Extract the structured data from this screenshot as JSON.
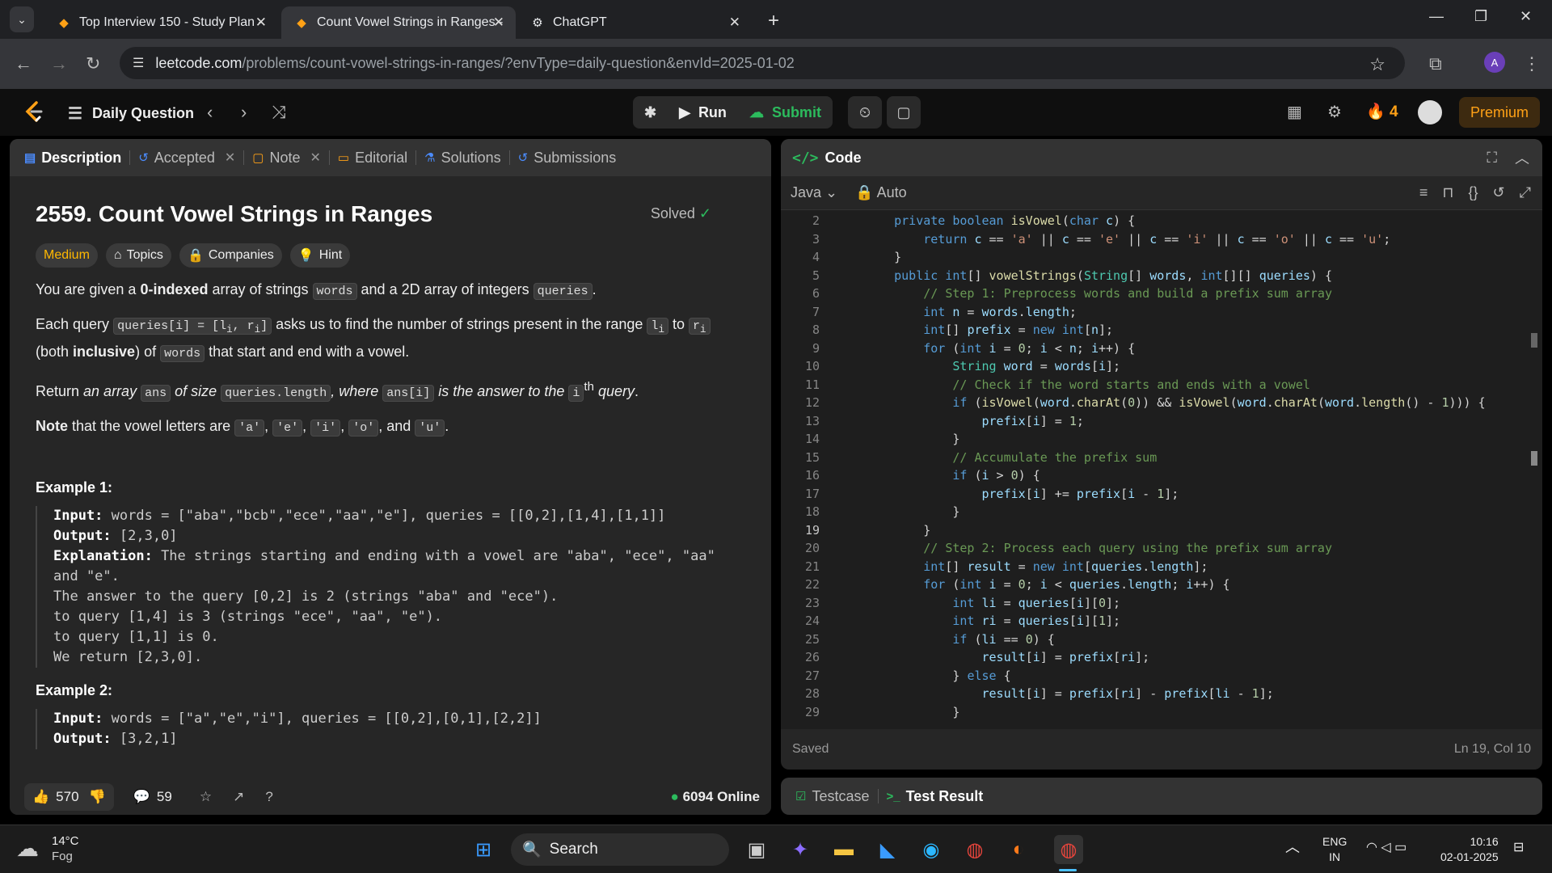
{
  "browser": {
    "tabs": [
      {
        "title": "Top Interview 150 - Study Plan -"
      },
      {
        "title": "Count Vowel Strings in Ranges -"
      },
      {
        "title": "ChatGPT"
      }
    ],
    "url_domain": "leetcode.com",
    "url_path": "/problems/count-vowel-strings-in-ranges/?envType=daily-question&envId=2025-01-02",
    "profile_initial": "A"
  },
  "header": {
    "daily_question": "Daily Question",
    "run": "Run",
    "submit": "Submit",
    "streak": "4",
    "premium": "Premium"
  },
  "left_tabs": {
    "description": "Description",
    "accepted": "Accepted",
    "note": "Note",
    "editorial": "Editorial",
    "solutions": "Solutions",
    "submissions": "Submissions"
  },
  "problem": {
    "title": "2559. Count Vowel Strings in Ranges",
    "status": "Solved",
    "difficulty": "Medium",
    "topics": "Topics",
    "companies": "Companies",
    "hint": "Hint",
    "example1_h": "Example 1:",
    "example2_h": "Example 2:"
  },
  "stats": {
    "likes": "570",
    "comments": "59",
    "online": "6094 Online"
  },
  "code": {
    "header": "Code",
    "language": "Java",
    "mode": "Auto",
    "saved": "Saved",
    "cursor": "Ln 19, Col 10"
  },
  "result_tabs": {
    "testcase": "Testcase",
    "test_result": "Test Result"
  },
  "taskbar": {
    "temp": "14°C",
    "weather": "Fog",
    "search": "Search",
    "lang1": "ENG",
    "lang2": "IN",
    "time": "10:16",
    "date": "02-01-2025"
  },
  "colors": {
    "accent": "#ffa116",
    "success": "#2cbb5d",
    "editor_bg": "#1e1e1e"
  }
}
